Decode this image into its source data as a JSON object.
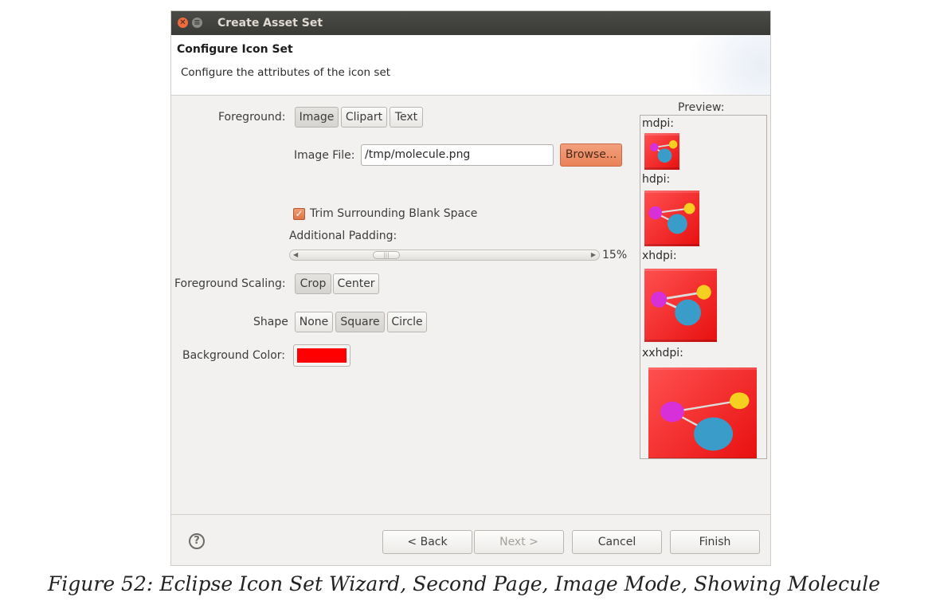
{
  "window": {
    "title": "Create Asset Set"
  },
  "header": {
    "title": "Configure Icon Set",
    "subtitle": "Configure the attributes of the icon set"
  },
  "foreground": {
    "label": "Foreground:",
    "options": [
      "Image",
      "Clipart",
      "Text"
    ],
    "selected": "Image"
  },
  "image_file": {
    "label": "Image File:",
    "value": "/tmp/molecule.png",
    "browse_label": "Browse..."
  },
  "trim": {
    "label": "Trim Surrounding Blank Space",
    "checked": true
  },
  "padding": {
    "label": "Additional Padding:",
    "value": "15%",
    "fraction": 0.15
  },
  "scaling": {
    "label": "Foreground Scaling:",
    "options": [
      "Crop",
      "Center"
    ],
    "selected": "Crop"
  },
  "shape": {
    "label": "Shape",
    "options": [
      "None",
      "Square",
      "Circle"
    ],
    "selected": "Square"
  },
  "background": {
    "label": "Background Color:",
    "color": "#ff0000"
  },
  "preview": {
    "title": "Preview:",
    "densities": [
      "mdpi:",
      "hdpi:",
      "xhdpi:",
      "xxhdpi:"
    ]
  },
  "footer": {
    "help_icon": "?",
    "back_label": "< Back",
    "next_label": "Next >",
    "cancel_label": "Cancel",
    "finish_label": "Finish"
  },
  "icons": {
    "close": "close-icon",
    "menu": "window-menu-icon",
    "check": "checkmark-icon",
    "help": "help-icon"
  },
  "caption": "Figure 52: Eclipse Icon Set Wizard, Second Page, Image Mode, Showing Molecule"
}
